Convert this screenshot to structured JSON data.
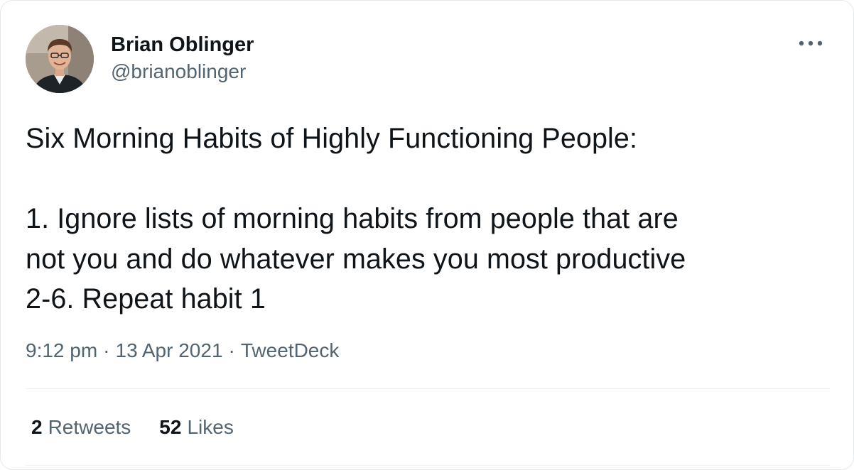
{
  "author": {
    "display_name": "Brian Oblinger",
    "handle": "@brianoblinger"
  },
  "more_icon": "more-horizontal-icon",
  "tweet": {
    "title_line": "Six Morning Habits of Highly Functioning People:",
    "body_lines": [
      "1. Ignore lists of morning habits from people that are",
      "not you and do whatever makes you most productive",
      "2-6. Repeat habit 1"
    ]
  },
  "meta": {
    "time": "9:12 pm",
    "separator": "·",
    "date": "13 Apr 2021",
    "source": "TweetDeck"
  },
  "stats": {
    "retweets_count": "2",
    "retweets_label": "Retweets",
    "likes_count": "52",
    "likes_label": "Likes"
  },
  "colors": {
    "text_primary": "#0f1419",
    "text_secondary": "#536471",
    "divider": "#eff3f4"
  }
}
